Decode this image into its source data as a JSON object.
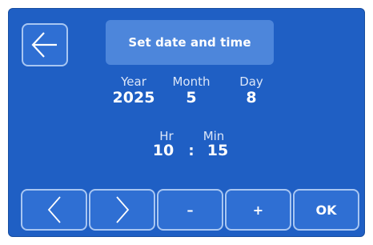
{
  "header": {
    "title": "Set date and time"
  },
  "date": {
    "year_label": "Year",
    "year_value": "2025",
    "month_label": "Month",
    "month_value": "5",
    "day_label": "Day",
    "day_value": "8"
  },
  "time": {
    "hour_label": "Hr",
    "hour_value": "10",
    "separator": ":",
    "minute_label": "Min",
    "minute_value": "15"
  },
  "buttons": {
    "back_icon": "arrow-left-icon",
    "prev_icon": "chevron-left-icon",
    "next_icon": "chevron-right-icon",
    "minus_label": "–",
    "plus_label": "+",
    "ok_label": "OK"
  },
  "colors": {
    "background": "#1f5fc4",
    "title_box": "#4d86db",
    "button_fill": "#2f6fd3",
    "button_border": "#a8c6f2",
    "text": "#ffffff"
  }
}
